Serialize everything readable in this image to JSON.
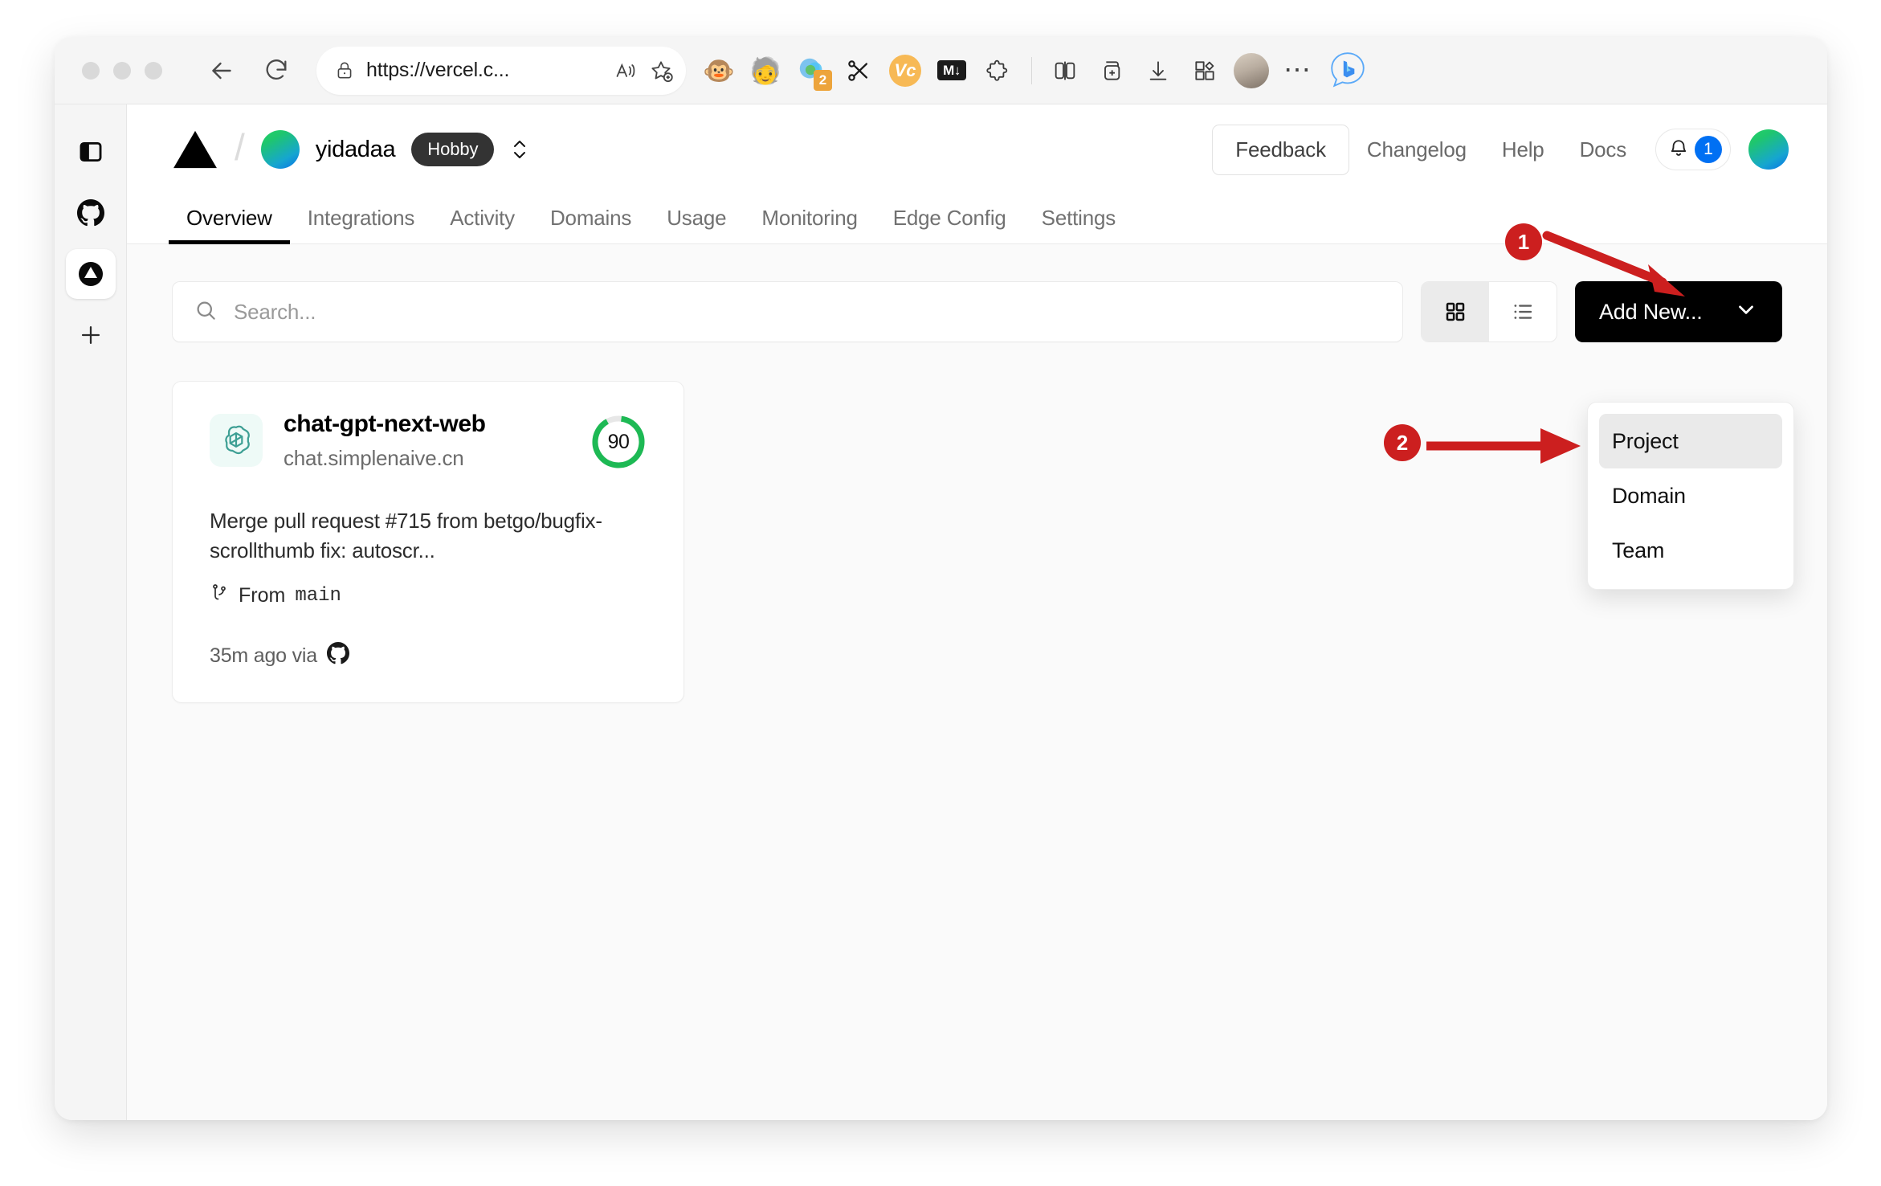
{
  "browser": {
    "window_controls": [
      "close",
      "minimize",
      "maximize"
    ],
    "back_label": "back-arrow",
    "reload_label": "reload",
    "url": {
      "scheme": "https://",
      "host": "vercel.c...",
      "full_display": "https://vercel.c...",
      "lock": "lock-icon"
    },
    "url_actions": [
      {
        "name": "read-aloud-icon",
        "glyph": "A"
      },
      {
        "name": "add-favorite-icon",
        "glyph": "star"
      }
    ],
    "extensions": [
      {
        "name": "monkey-extension-icon",
        "glyph": "🐵",
        "badge": null
      },
      {
        "name": "scientist-extension-icon",
        "glyph": "🧓",
        "badge": null
      },
      {
        "name": "circles-extension-icon",
        "glyph": "circles",
        "badge": "2"
      },
      {
        "name": "scissors-extension-icon",
        "glyph": "✂",
        "badge": null
      },
      {
        "name": "vc-extension-icon",
        "glyph": "V",
        "badge": null
      },
      {
        "name": "markdown-extension-icon",
        "glyph": "M↓",
        "badge": null
      },
      {
        "name": "puzzle-extensions-icon",
        "glyph": "puzzle",
        "badge": null
      }
    ],
    "right_actions": [
      {
        "name": "split-screen-icon"
      },
      {
        "name": "add-to-collections-icon"
      },
      {
        "name": "downloads-icon"
      },
      {
        "name": "browser-essentials-icon"
      },
      {
        "name": "profile-avatar"
      },
      {
        "name": "settings-more-icon",
        "glyph": "…"
      },
      {
        "name": "bing-copilot-icon",
        "glyph": "b"
      }
    ]
  },
  "rail": {
    "items": [
      {
        "name": "sidebar-toggle-icon",
        "label": "Toggle sidebar",
        "active": false
      },
      {
        "name": "github-icon",
        "label": "GitHub",
        "active": false
      },
      {
        "name": "vercel-icon",
        "label": "Vercel",
        "active": true
      },
      {
        "name": "add-icon",
        "label": "Add",
        "active": false
      }
    ]
  },
  "header": {
    "logo": "vercel-triangle-logo",
    "separator": "/",
    "team": "yidadaa",
    "plan": "Hobby",
    "scope_switcher": "chevron-up-down-icon",
    "feedback": "Feedback",
    "links": [
      "Changelog",
      "Help",
      "Docs"
    ],
    "notifications": {
      "icon": "bell-icon",
      "count": "1"
    },
    "avatar": "user-avatar"
  },
  "tabs": [
    {
      "label": "Overview",
      "active": true
    },
    {
      "label": "Integrations",
      "active": false
    },
    {
      "label": "Activity",
      "active": false
    },
    {
      "label": "Domains",
      "active": false
    },
    {
      "label": "Usage",
      "active": false
    },
    {
      "label": "Monitoring",
      "active": false
    },
    {
      "label": "Edge Config",
      "active": false
    },
    {
      "label": "Settings",
      "active": false
    }
  ],
  "toolbar": {
    "search_placeholder": "Search...",
    "search_value": "",
    "search_icon": "search-icon",
    "view_modes": [
      {
        "name": "grid-view-button",
        "icon": "grid-icon",
        "active": true
      },
      {
        "name": "list-view-button",
        "icon": "list-icon",
        "active": false
      }
    ],
    "add_new_label": "Add New...",
    "add_new_chevron": "chevron-down-icon"
  },
  "dropdown": {
    "items": [
      {
        "label": "Project",
        "hovered": true
      },
      {
        "label": "Domain",
        "hovered": false
      },
      {
        "label": "Team",
        "hovered": false
      }
    ]
  },
  "projects": [
    {
      "logo": "openai-icon",
      "name": "chat-gpt-next-web",
      "domain": "chat.simplenaive.cn",
      "score": "90",
      "score_color": "#1db954",
      "commit_message": "Merge pull request #715 from betgo/bugfix-scrollthumb fix: autoscr...",
      "branch_icon": "git-branch-icon",
      "branch_prefix": "From",
      "branch": "main",
      "time": "35m ago via",
      "source_icon": "github-icon"
    }
  ],
  "annotations": [
    {
      "number": "1",
      "target": "add-new-button"
    },
    {
      "number": "2",
      "target": "dropdown-project-item"
    }
  ],
  "colors": {
    "accent_black": "#000000",
    "annotation_red": "#cc1f1f",
    "notification_blue": "#0070f3",
    "score_green": "#1db954",
    "page_background": "#fafafa"
  }
}
